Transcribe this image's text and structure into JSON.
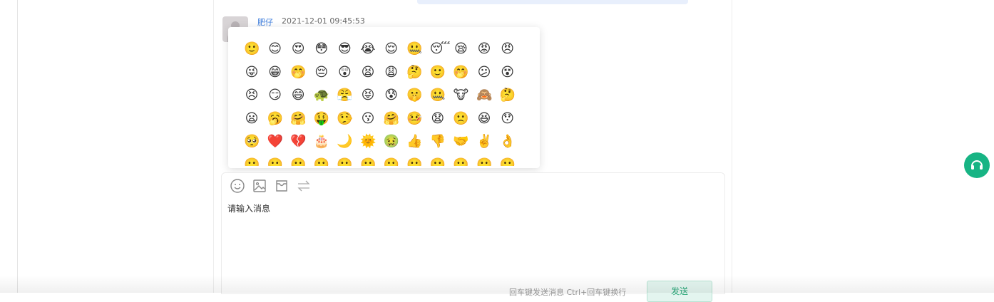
{
  "message": {
    "sender": "肥仔",
    "time": "2021-12-01 09:45:53"
  },
  "emoji_panel": {
    "rows": [
      [
        "🙂",
        "😊",
        "😍",
        "😳",
        "😎",
        "😭",
        "😌",
        "🤐",
        "😴",
        "😪",
        "😡",
        "😠"
      ],
      [
        "😜",
        "😁",
        "🤭",
        "😔",
        "😲",
        "😫",
        "😩",
        "🤔",
        "🙂",
        "🤭",
        "😕",
        "😵"
      ],
      [
        "😣",
        "😏",
        "😄",
        "🐢",
        "😤",
        "😝",
        "😰",
        "🤫",
        "🤐",
        "🐮",
        "🙈",
        "🤔"
      ],
      [
        "😦",
        "🥱",
        "🤗",
        "🤑",
        "🤥",
        "😗",
        "🤗",
        "🤒",
        "😧",
        "🙁",
        "😆",
        "😯"
      ],
      [
        "🥺",
        "❤️",
        "💔",
        "🎂",
        "🌙",
        "🌞",
        "🤢",
        "👍",
        "👎",
        "🤝",
        "✌️",
        "👌"
      ],
      [
        "🙂",
        "🙂",
        "🙂",
        "🙂",
        "🙂",
        "🙂",
        "🙂",
        "🙂",
        "🙂",
        "🙂",
        "🙂",
        "🙂"
      ]
    ]
  },
  "toolbar": {
    "icons": [
      "emoji-icon",
      "image-icon",
      "inbox-icon",
      "transfer-icon"
    ]
  },
  "input": {
    "placeholder": "请输入消息"
  },
  "send": {
    "hint": "回车键发送消息 Ctrl+回车键换行",
    "label": "发送"
  },
  "colors": {
    "accent": "#17b484",
    "name_link": "#3a7bdc",
    "send_bg": "#e3f5ef"
  }
}
